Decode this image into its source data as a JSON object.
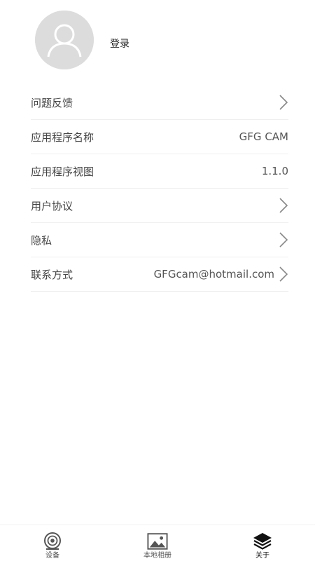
{
  "profile": {
    "login_label": "登录"
  },
  "settings": {
    "feedback": {
      "label": "问题反馈"
    },
    "app_name": {
      "label": "应用程序名称",
      "value": "GFG CAM"
    },
    "app_version": {
      "label": "应用程序视图",
      "value": "1.1.0"
    },
    "user_agreement": {
      "label": "用户协议"
    },
    "privacy": {
      "label": "隐私"
    },
    "contact": {
      "label": "联系方式",
      "value": "GFGcam@hotmail.com"
    }
  },
  "tabbar": {
    "tabs": [
      {
        "label": "设备",
        "icon": "camera-icon",
        "active": false
      },
      {
        "label": "本地相册",
        "icon": "image-icon",
        "active": false
      },
      {
        "label": "关于",
        "icon": "layers-icon",
        "active": true
      }
    ]
  }
}
